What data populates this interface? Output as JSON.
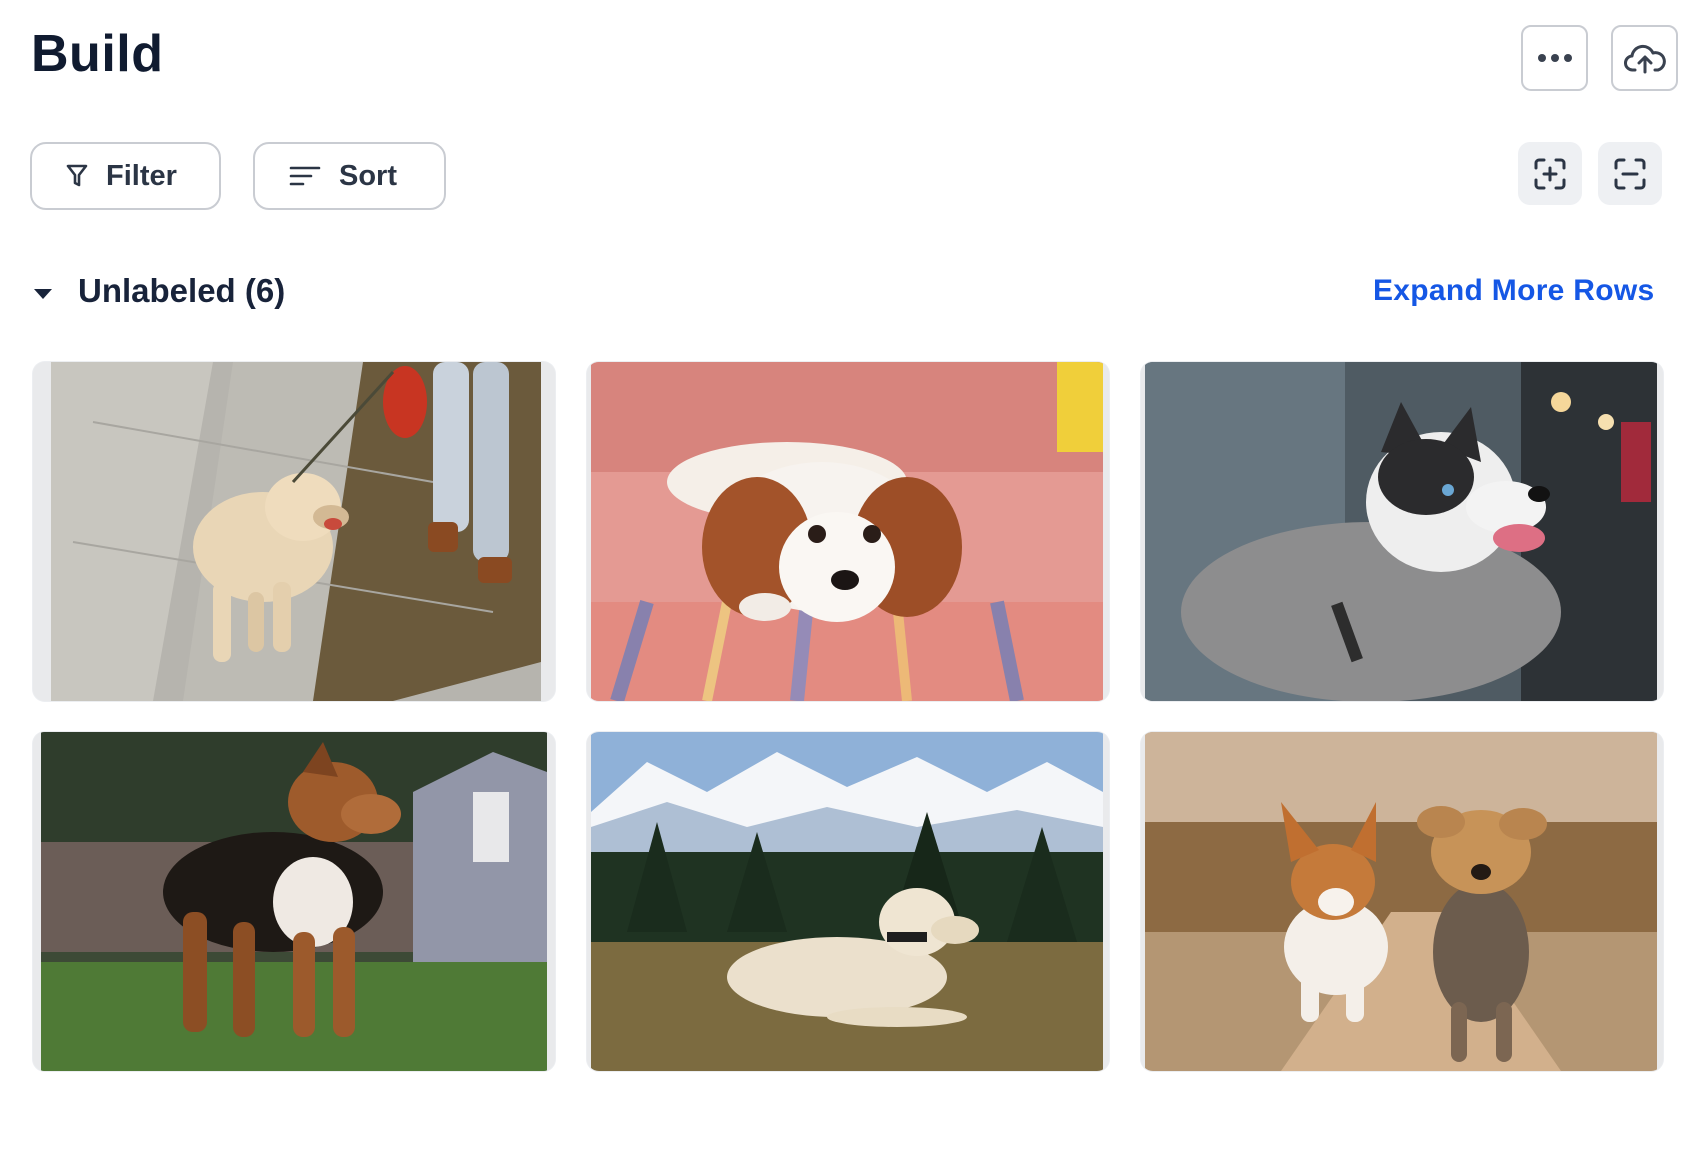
{
  "header": {
    "title": "Build",
    "more_icon": "more-horizontal-icon",
    "upload_icon": "cloud-upload-icon"
  },
  "toolbar": {
    "filter_label": "Filter",
    "filter_icon": "funnel-icon",
    "sort_label": "Sort",
    "sort_icon": "sort-lines-icon",
    "add_icon": "frame-plus-icon",
    "remove_icon": "frame-minus-icon"
  },
  "group": {
    "title": "Unlabeled (6)",
    "toggle_icon": "caret-down-icon",
    "expand_label": "Expand More Rows"
  },
  "images": [
    {
      "subject": "golden retriever walking on leash"
    },
    {
      "subject": "cavalier puppy lying on striped blanket"
    },
    {
      "subject": "husky with tongue out"
    },
    {
      "subject": "brown dog standing on grass"
    },
    {
      "subject": "labrador lying in mountain meadow"
    },
    {
      "subject": "corgi and yorkie running on path"
    }
  ],
  "colors": {
    "accent_link": "#1557e5",
    "title": "#101b30",
    "border": "#c9ccd2",
    "button_grey": "#eef0f3"
  }
}
